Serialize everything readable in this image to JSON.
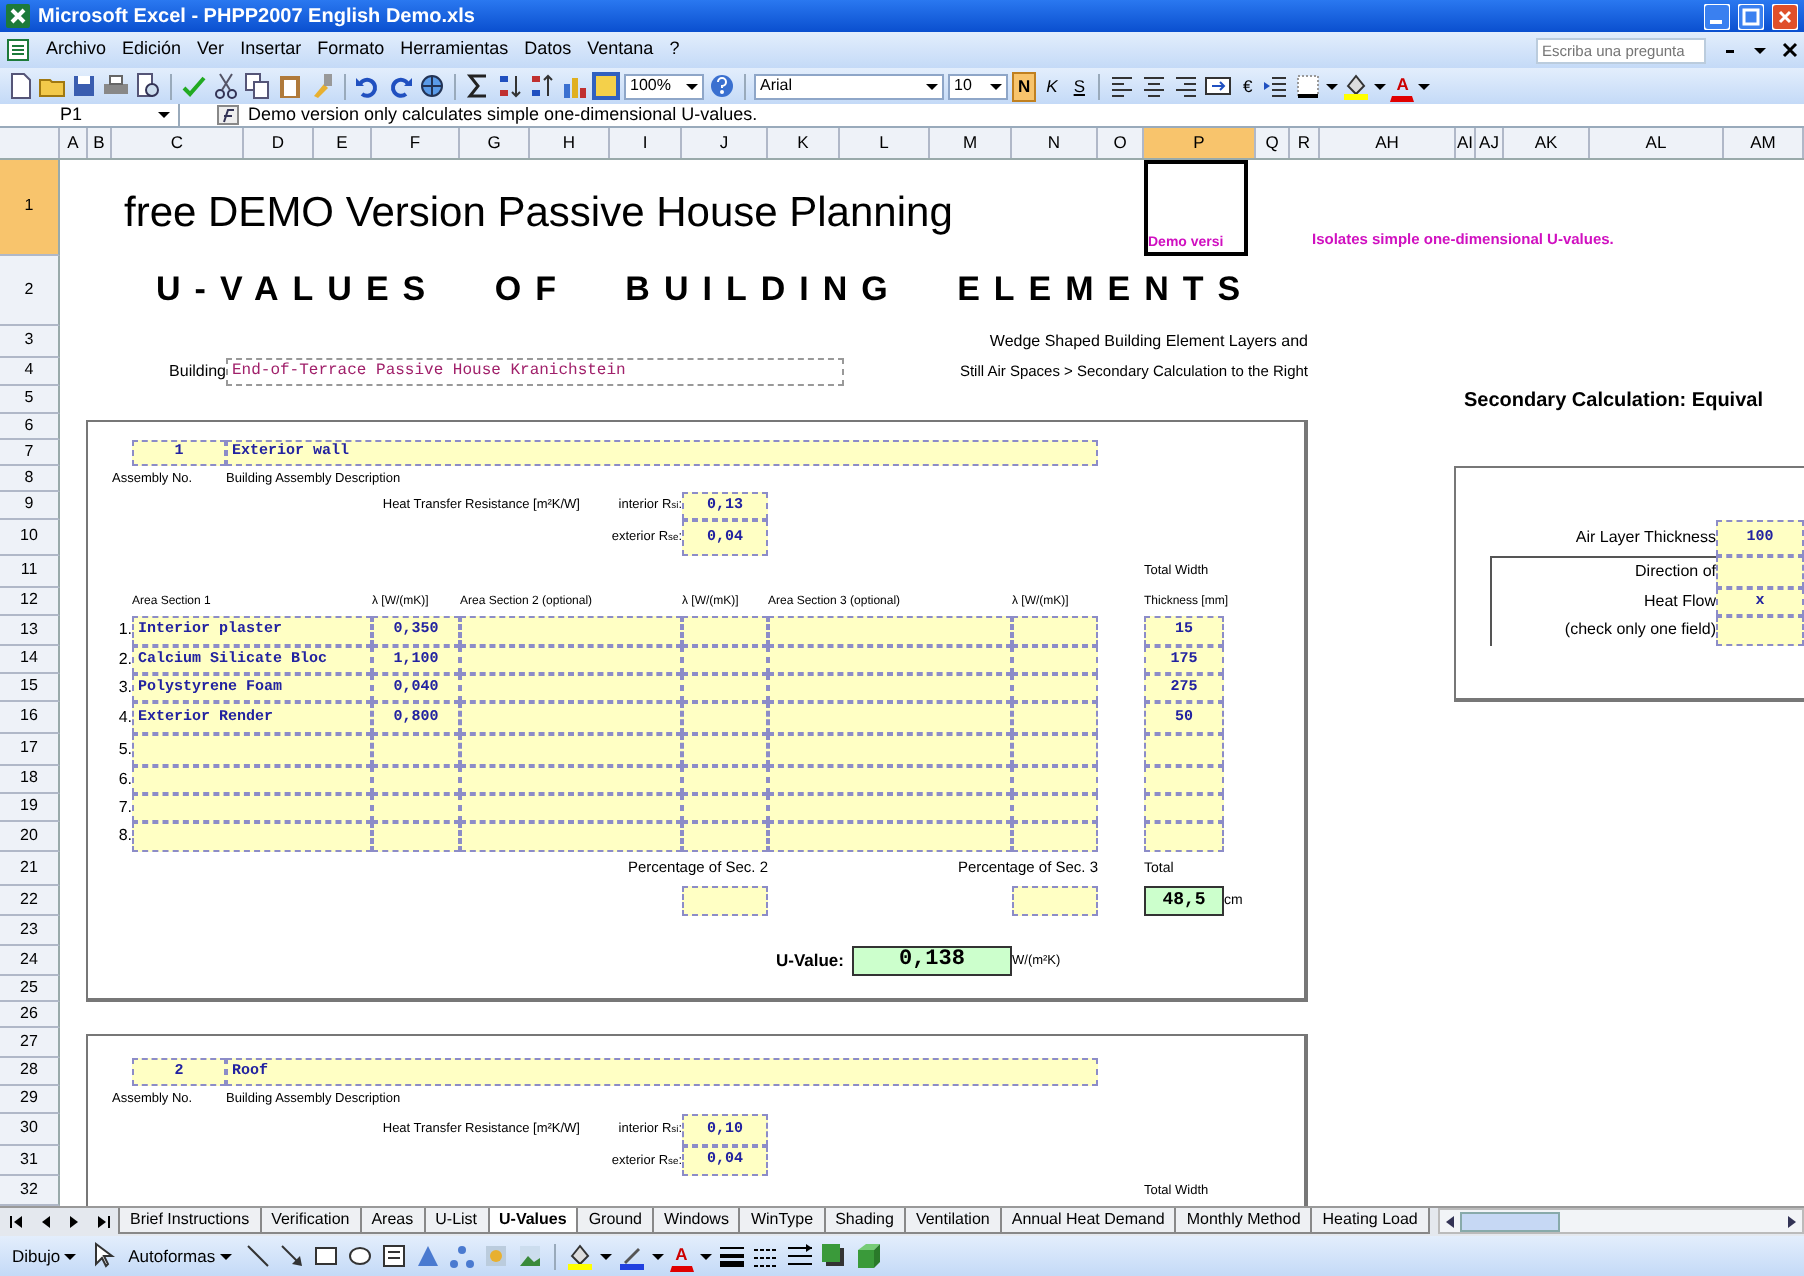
{
  "window": {
    "title": "Microsoft Excel - PHPP2007 English Demo.xls"
  },
  "menu": [
    "Archivo",
    "Edición",
    "Ver",
    "Insertar",
    "Formato",
    "Herramientas",
    "Datos",
    "Ventana",
    "?"
  ],
  "help_box": {
    "placeholder": "Escriba una pregunta"
  },
  "toolbar": {
    "zoom": "100%",
    "font": "Arial",
    "size": "10",
    "format_buttons": [
      {
        "label": "N",
        "selected": true
      },
      {
        "label": "K",
        "selected": false
      },
      {
        "label": "S",
        "selected": false
      }
    ],
    "currency": "€",
    "font_color": "A"
  },
  "formula_bar": {
    "cell": "P1",
    "content": "Demo version only calculates simple one-dimensional U-values."
  },
  "columns": [
    {
      "label": "A",
      "selected": false
    },
    {
      "label": "B",
      "selected": false
    },
    {
      "label": "C",
      "selected": false
    },
    {
      "label": "D",
      "selected": false
    },
    {
      "label": "E",
      "selected": false
    },
    {
      "label": "F",
      "selected": false
    },
    {
      "label": "G",
      "selected": false
    },
    {
      "label": "H",
      "selected": false
    },
    {
      "label": "I",
      "selected": false
    },
    {
      "label": "J",
      "selected": false
    },
    {
      "label": "K",
      "selected": false
    },
    {
      "label": "L",
      "selected": false
    },
    {
      "label": "M",
      "selected": false
    },
    {
      "label": "N",
      "selected": false
    },
    {
      "label": "O",
      "selected": false
    },
    {
      "label": "P",
      "selected": true
    },
    {
      "label": "Q",
      "selected": false
    },
    {
      "label": "R",
      "selected": false
    },
    {
      "label": "AH",
      "selected": false
    },
    {
      "label": "AI",
      "selected": false
    },
    {
      "label": "AJ",
      "selected": false
    },
    {
      "label": "AK",
      "selected": false
    },
    {
      "label": "AL",
      "selected": false
    },
    {
      "label": "AM",
      "selected": false
    }
  ],
  "rows": [
    {
      "label": "1",
      "selected": true
    },
    {
      "label": "2",
      "selected": false
    },
    {
      "label": "3",
      "selected": false
    },
    {
      "label": "4",
      "selected": false
    },
    {
      "label": "5",
      "selected": false
    },
    {
      "label": "6",
      "selected": false
    },
    {
      "label": "7",
      "selected": false
    },
    {
      "label": "8",
      "selected": false
    },
    {
      "label": "9",
      "selected": false
    },
    {
      "label": "10",
      "selected": false
    },
    {
      "label": "11",
      "selected": false
    },
    {
      "label": "12",
      "selected": false
    },
    {
      "label": "13",
      "selected": false
    },
    {
      "label": "14",
      "selected": false
    },
    {
      "label": "15",
      "selected": false
    },
    {
      "label": "16",
      "selected": false
    },
    {
      "label": "17",
      "selected": false
    },
    {
      "label": "18",
      "selected": false
    },
    {
      "label": "19",
      "selected": false
    },
    {
      "label": "20",
      "selected": false
    },
    {
      "label": "21",
      "selected": false
    },
    {
      "label": "22",
      "selected": false
    },
    {
      "label": "23",
      "selected": false
    },
    {
      "label": "24",
      "selected": false
    },
    {
      "label": "25",
      "selected": false
    },
    {
      "label": "26",
      "selected": false
    },
    {
      "label": "27",
      "selected": false
    },
    {
      "label": "28",
      "selected": false
    },
    {
      "label": "29",
      "selected": false
    },
    {
      "label": "30",
      "selected": false
    },
    {
      "label": "31",
      "selected": false
    },
    {
      "label": "32",
      "selected": false
    }
  ],
  "sheet": {
    "title": "free DEMO Version Passive House Planning",
    "subtitle": "U-VALUES OF BUILDING ELEMENTS",
    "demo_cell": "Demo versi",
    "demo_note": "Isolates simple one-dimensional U-values.",
    "wedge_note": "Wedge Shaped Building Element Layers and",
    "still_air_note": "Still Air Spaces > Secondary Calculation to the Right",
    "building": {
      "label": "Building",
      "value": "End-of-Terrace Passive House Kranichstein"
    },
    "assemblies": [
      {
        "number": "1",
        "description": "Exterior wall",
        "number_label": "Assembly No.",
        "description_label": "Building Assembly Description",
        "resistance_label": "Heat Transfer Resistance [m²K/W]",
        "interior_label": "interior R$_{si}$:",
        "interior_value": "0,13",
        "exterior_label": "exterior R$_{se}$:",
        "exterior_value": "0,04",
        "total_width_label": "Total Width",
        "columns": [
          "Area Section 1",
          "λ [W/(mK)]",
          "Area Section 2 (optional)",
          "λ [W/(mK)]",
          "Area Section 3 (optional)",
          "λ [W/(mK)]",
          "Thickness [mm]"
        ],
        "layers": [
          {
            "index": "1.",
            "name": "Interior plaster",
            "lambda": "0,350",
            "thickness": "15"
          },
          {
            "index": "2.",
            "name": "Calcium Silicate Bloc",
            "lambda": "1,100",
            "thickness": "175"
          },
          {
            "index": "3.",
            "name": "Polystyrene Foam",
            "lambda": "0,040",
            "thickness": "275"
          },
          {
            "index": "4.",
            "name": "Exterior Render",
            "lambda": "0,800",
            "thickness": "50"
          },
          {
            "index": "5."
          },
          {
            "index": "6."
          },
          {
            "index": "7."
          },
          {
            "index": "8."
          }
        ],
        "percentage2_label": "Percentage of Sec. 2",
        "percentage3_label": "Percentage of Sec. 3",
        "total_label": "Total",
        "total": "48,5",
        "total_unit": "cm",
        "u_label": "U-Value:",
        "u_value": "0,138",
        "u_unit": "W/(m²K)"
      },
      {
        "number": "2",
        "description": "Roof",
        "number_label": "Assembly No.",
        "description_label": "Building Assembly Description",
        "resistance_label": "Heat Transfer Resistance [m²K/W]",
        "interior_label": "interior R$_{si}$:",
        "interior_value": "0,10",
        "exterior_label": "exterior R$_{se}$:",
        "exterior_value": "0,04",
        "total_width_label": "Total Width"
      }
    ],
    "secondary": {
      "title": "Secondary Calculation: Equival",
      "air_label": "Air Layer Thickness",
      "air_value": "100",
      "direction_label": "Direction of",
      "heat_flow_label": "Heat Flow",
      "heat_flow_value": "x",
      "check_label": "(check only one field)"
    }
  },
  "sheet_tabs": [
    {
      "label": "Brief Instructions",
      "selected": false
    },
    {
      "label": "Verification",
      "selected": false
    },
    {
      "label": "Areas",
      "selected": false
    },
    {
      "label": "U-List",
      "selected": false
    },
    {
      "label": "U-Values",
      "selected": true
    },
    {
      "label": "Ground",
      "selected": false
    },
    {
      "label": "Windows",
      "selected": false
    },
    {
      "label": "WinType",
      "selected": false
    },
    {
      "label": "Shading",
      "selected": false
    },
    {
      "label": "Ventilation",
      "selected": false
    },
    {
      "label": "Annual Heat Demand",
      "selected": false
    },
    {
      "label": "Monthly Method",
      "selected": false
    },
    {
      "label": "Heating Load",
      "selected": false
    }
  ],
  "drawing_toolbar": {
    "draw": "Dibujo",
    "autoshapes": "Autoformas",
    "font_color": "A"
  }
}
